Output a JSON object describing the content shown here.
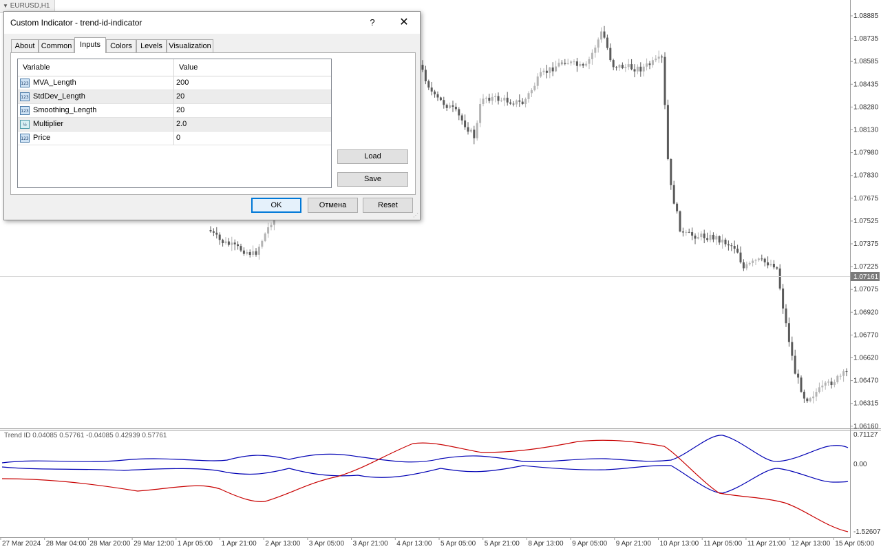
{
  "window": {
    "tab_title": "EURUSD,H1"
  },
  "price_axis": {
    "labels": [
      "1.08885",
      "1.08735",
      "1.08585",
      "1.08435",
      "1.08280",
      "1.08130",
      "1.07980",
      "1.07830",
      "1.07675",
      "1.07525",
      "1.07375",
      "1.07225",
      "1.07075",
      "1.06920",
      "1.06770",
      "1.06620",
      "1.06470",
      "1.06315",
      "1.06160"
    ],
    "current_price": "1.07161"
  },
  "time_axis": {
    "labels": [
      "27 Mar 2024",
      "28 Mar 04:00",
      "28 Mar 20:00",
      "29 Mar 12:00",
      "1 Apr 05:00",
      "1 Apr 21:00",
      "2 Apr 13:00",
      "3 Apr 05:00",
      "3 Apr 21:00",
      "4 Apr 13:00",
      "5 Apr 05:00",
      "5 Apr 21:00",
      "8 Apr 13:00",
      "9 Apr 05:00",
      "9 Apr 21:00",
      "10 Apr 13:00",
      "11 Apr 05:00",
      "11 Apr 21:00",
      "12 Apr 13:00",
      "15 Apr 05:00"
    ]
  },
  "indicator": {
    "title": "Trend ID 0.04085 0.57761 -0.04085 0.42939 0.57761",
    "axis_labels": [
      "0.71127",
      "0.00",
      "-1.52607"
    ],
    "colors": {
      "upper_band": "#0000b4",
      "lower_band": "#0000b4",
      "trend": "#c80000"
    }
  },
  "colors": {
    "bull_candle": "#b4b4b4",
    "bear_candle": "#5a5a5a",
    "accent": "#0078d7"
  },
  "dialog": {
    "title": "Custom Indicator - trend-id-indicator",
    "help_label": "?",
    "close_label": "✕",
    "tabs": [
      {
        "label": "About"
      },
      {
        "label": "Common"
      },
      {
        "label": "Inputs"
      },
      {
        "label": "Colors"
      },
      {
        "label": "Levels"
      },
      {
        "label": "Visualization"
      }
    ],
    "active_tab": "Inputs",
    "grid": {
      "col_variable": "Variable",
      "col_value": "Value",
      "rows": [
        {
          "icon": "123",
          "name": "MVA_Length",
          "value": "200"
        },
        {
          "icon": "123",
          "name": "StdDev_Length",
          "value": "20"
        },
        {
          "icon": "123",
          "name": "Smoothing_Length",
          "value": "20"
        },
        {
          "icon": "½",
          "name": "Multiplier",
          "value": "2.0"
        },
        {
          "icon": "123",
          "name": "Price",
          "value": "0"
        }
      ]
    },
    "load_label": "Load",
    "save_label": "Save",
    "ok_label": "OK",
    "cancel_label": "Отмена",
    "reset_label": "Reset"
  }
}
